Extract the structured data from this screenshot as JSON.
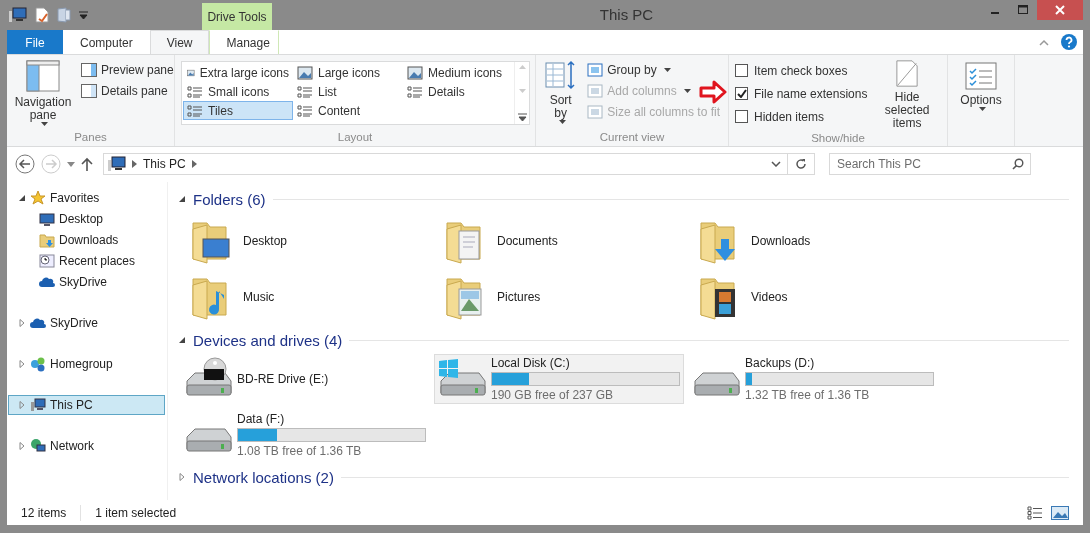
{
  "window": {
    "title": "This PC",
    "contextual_group": "Drive Tools"
  },
  "ribbon_tabs": [
    {
      "label": "File",
      "kind": "file",
      "selected": false
    },
    {
      "label": "Computer",
      "kind": "normal",
      "selected": false
    },
    {
      "label": "View",
      "kind": "normal",
      "selected": true
    },
    {
      "label": "Manage",
      "kind": "contextual",
      "selected": false
    }
  ],
  "panes_group": {
    "label": "Panes",
    "navigation_pane": "Navigation pane",
    "buttons": [
      "Preview pane",
      "Details pane"
    ]
  },
  "layout_group": {
    "label": "Layout",
    "items": [
      {
        "label": "Extra large icons",
        "selected": false
      },
      {
        "label": "Large icons",
        "selected": false
      },
      {
        "label": "Medium icons",
        "selected": false
      },
      {
        "label": "Small icons",
        "selected": false
      },
      {
        "label": "List",
        "selected": false
      },
      {
        "label": "Details",
        "selected": false
      },
      {
        "label": "Tiles",
        "selected": true
      },
      {
        "label": "Content",
        "selected": false
      }
    ]
  },
  "current_view_group": {
    "label": "Current view",
    "sort_by": "Sort by",
    "commands": [
      {
        "label": "Group by",
        "disabled": false
      },
      {
        "label": "Add columns",
        "disabled": true
      },
      {
        "label": "Size all columns to fit",
        "disabled": true
      }
    ]
  },
  "show_hide_group": {
    "label": "Show/hide",
    "checkboxes": [
      {
        "label": "Item check boxes",
        "checked": false
      },
      {
        "label": "File name extensions",
        "checked": true
      },
      {
        "label": "Hidden items",
        "checked": false
      }
    ],
    "hide_selected": "Hide selected items"
  },
  "options_button": "Options",
  "address_bar": {
    "path": "This PC",
    "search_placeholder": "Search This PC"
  },
  "navigation_pane": [
    {
      "label": "Favorites",
      "expanded": true,
      "selected": false,
      "children": [
        {
          "label": "Desktop",
          "selected": false
        },
        {
          "label": "Downloads",
          "selected": false
        },
        {
          "label": "Recent places",
          "selected": false
        },
        {
          "label": "SkyDrive",
          "selected": false
        }
      ]
    },
    {
      "label": "SkyDrive",
      "expanded": false,
      "selected": false
    },
    {
      "label": "Homegroup",
      "expanded": false,
      "selected": false
    },
    {
      "label": "This PC",
      "expanded": false,
      "selected": true
    },
    {
      "label": "Network",
      "expanded": false,
      "selected": false
    }
  ],
  "sections": [
    {
      "title": "Folders (6)",
      "expanded": true,
      "kind": "folders",
      "items": [
        {
          "label": "Desktop"
        },
        {
          "label": "Documents"
        },
        {
          "label": "Downloads"
        },
        {
          "label": "Music"
        },
        {
          "label": "Pictures"
        },
        {
          "label": "Videos"
        }
      ]
    },
    {
      "title": "Devices and drives (4)",
      "expanded": true,
      "kind": "drives",
      "items": [
        {
          "name": "BD-RE Drive (E:)",
          "kind": "optical",
          "selected": false
        },
        {
          "name": "Local Disk (C:)",
          "kind": "system",
          "level": 0.2,
          "free": "190 GB free of 237 GB",
          "selected": true
        },
        {
          "name": "Backups (D:)",
          "kind": "disk",
          "level": 0.03,
          "free": "1.32 TB free of 1.36 TB",
          "selected": false
        },
        {
          "name": "Data (F:)",
          "kind": "disk",
          "level": 0.21,
          "free": "1.08 TB free of 1.36 TB",
          "selected": false
        }
      ]
    },
    {
      "title": "Network locations (2)",
      "expanded": false
    }
  ],
  "status_bar": {
    "item_count": "12 items",
    "selection": "1 item selected"
  }
}
